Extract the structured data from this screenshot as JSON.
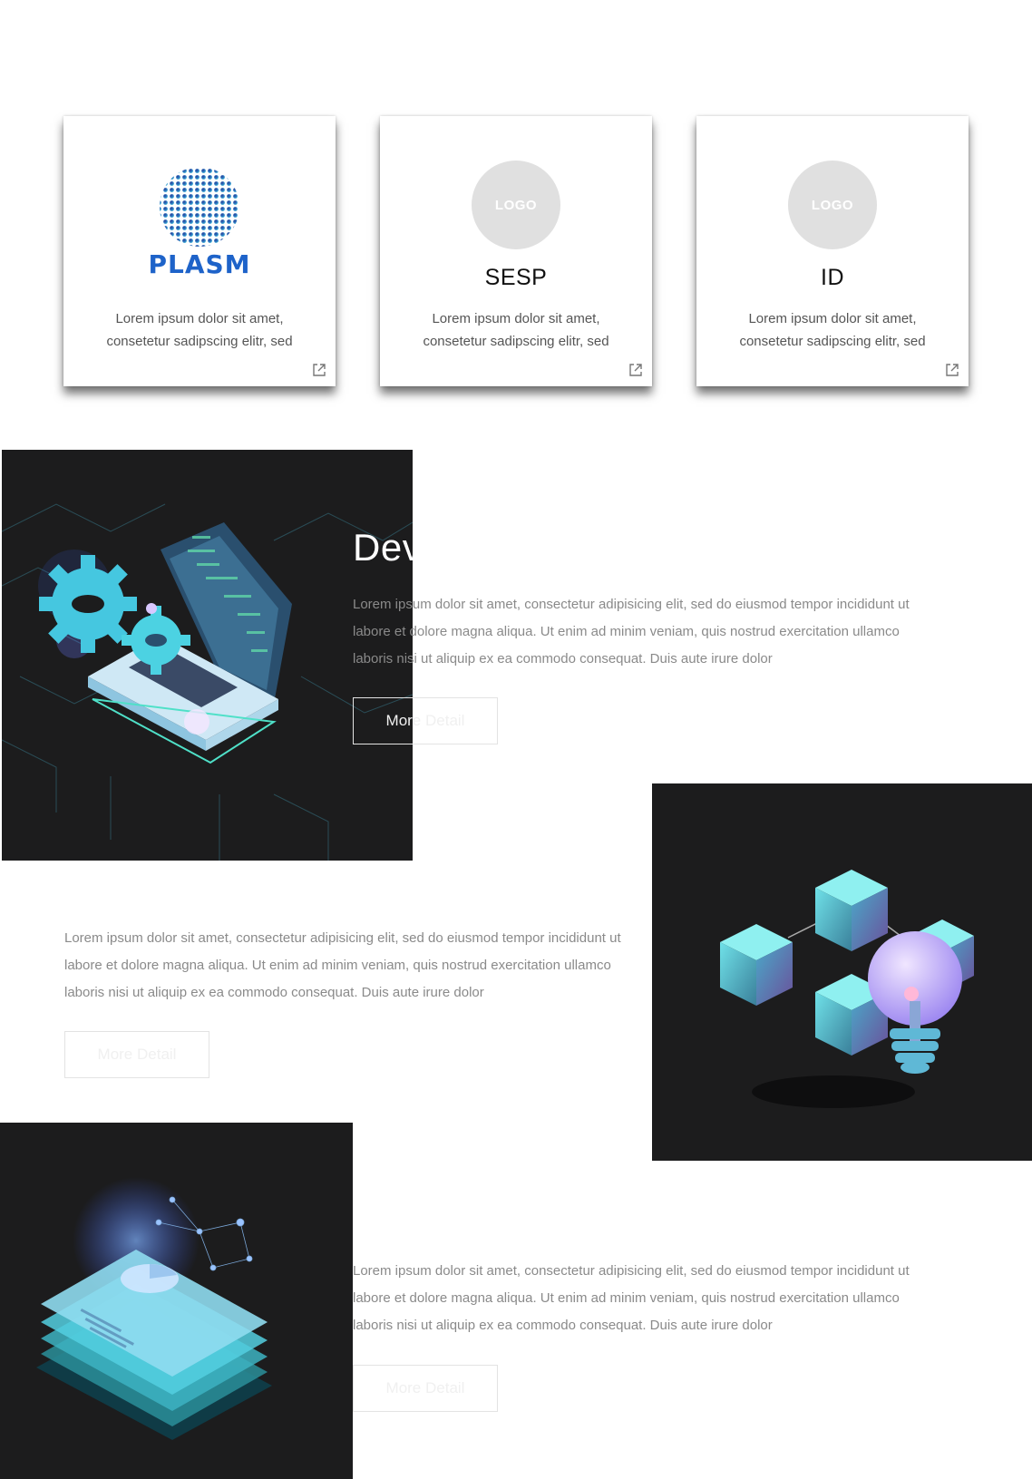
{
  "cards": [
    {
      "logo_text": "PLASM",
      "name": "",
      "description_line1": "Lorem ipsum dolor sit amet,",
      "description_line2": "consetetur sadipscing elitr, sed",
      "link_icon": "external-link-icon"
    },
    {
      "logo_text": "LOGO",
      "name": "SESP",
      "description_line1": "Lorem ipsum dolor sit amet,",
      "description_line2": "consetetur sadipscing elitr, sed",
      "link_icon": "external-link-icon"
    },
    {
      "logo_text": "LOGO",
      "name": "ID",
      "description_line1": "Lorem ipsum dolor sit amet,",
      "description_line2": "consetetur sadipscing elitr, sed",
      "link_icon": "external-link-icon"
    }
  ],
  "features": [
    {
      "heading": "Dev",
      "line1": "Lorem ipsum dolor sit amet, consectetur adipisicing elit, sed do eiusmod tempor incididunt ut",
      "line2": "labore et dolore magna aliqua. Ut enim ad minim veniam, quis nostrud exercitation ullamco",
      "line3": "laboris nisi ut aliquip ex ea commodo consequat. Duis aute irure dolor",
      "button_label": "More Detail",
      "illustration": "laptop-gears-illustration"
    },
    {
      "heading": "",
      "line1": "Lorem ipsum dolor sit amet, consectetur adipisicing elit, sed do eiusmod tempor incididunt ut",
      "line2": "labore et dolore magna aliqua. Ut enim ad minim veniam, quis nostrud exercitation ullamco",
      "line3": "laboris nisi ut aliquip ex ea commodo consequat. Duis aute irure dolor",
      "button_label": "More Detail",
      "illustration": "cubes-lightbulb-illustration"
    },
    {
      "heading": "",
      "line1": "Lorem ipsum dolor sit amet, consectetur adipisicing elit, sed do eiusmod tempor incididunt ut",
      "line2": "labore et dolore magna aliqua. Ut enim ad minim veniam, quis nostrud exercitation ullamco",
      "line3": "laboris nisi ut aliquip ex ea commodo consequat. Duis aute irure dolor",
      "button_label": "More Detail",
      "illustration": "data-layers-illustration"
    }
  ],
  "colors": {
    "dark_panel": "#1c1c1d",
    "accent_cyan": "#5fd6d6",
    "plasm_blue": "#1e63c9",
    "logo_gray": "#e0e0e0"
  }
}
